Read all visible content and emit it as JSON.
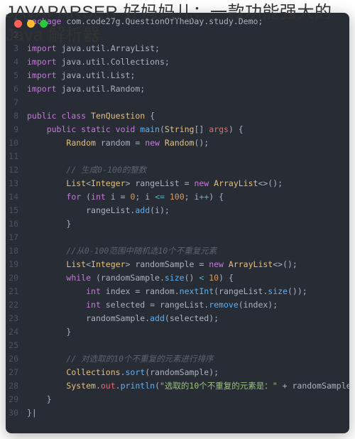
{
  "title": "JAVAPARSER 好妈妈儿：一款功能强大的 Java 解析器",
  "code": {
    "lines": [
      {
        "n": 1,
        "indent": 0,
        "tokens": [
          [
            "kw",
            "package"
          ],
          [
            "pkg",
            " com.code27g.QuestionOfTheDay.study.Demo"
          ],
          [
            "punct",
            ";"
          ]
        ]
      },
      {
        "n": 2,
        "indent": 0,
        "tokens": []
      },
      {
        "n": 3,
        "indent": 0,
        "tokens": [
          [
            "kw",
            "import"
          ],
          [
            "pkg",
            " java.util.ArrayList"
          ],
          [
            "punct",
            ";"
          ]
        ]
      },
      {
        "n": 4,
        "indent": 0,
        "tokens": [
          [
            "kw",
            "import"
          ],
          [
            "pkg",
            " java.util.Collections"
          ],
          [
            "punct",
            ";"
          ]
        ]
      },
      {
        "n": 5,
        "indent": 0,
        "tokens": [
          [
            "kw",
            "import"
          ],
          [
            "pkg",
            " java.util.List"
          ],
          [
            "punct",
            ";"
          ]
        ]
      },
      {
        "n": 6,
        "indent": 0,
        "tokens": [
          [
            "kw",
            "import"
          ],
          [
            "pkg",
            " java.util.Random"
          ],
          [
            "punct",
            ";"
          ]
        ]
      },
      {
        "n": 7,
        "indent": 0,
        "tokens": []
      },
      {
        "n": 8,
        "indent": 0,
        "tokens": [
          [
            "kw",
            "public class "
          ],
          [
            "type",
            "TenQuestion"
          ],
          [
            "punct",
            " {"
          ]
        ]
      },
      {
        "n": 9,
        "indent": 1,
        "tokens": [
          [
            "kw",
            "public static "
          ],
          [
            "kw",
            "void "
          ],
          [
            "fn",
            "main"
          ],
          [
            "punct",
            "("
          ],
          [
            "type",
            "String"
          ],
          [
            "punct",
            "[] "
          ],
          [
            "var",
            "args"
          ],
          [
            "punct",
            ") {"
          ]
        ]
      },
      {
        "n": 10,
        "indent": 2,
        "tokens": [
          [
            "type",
            "Random"
          ],
          [
            "punct",
            " random = "
          ],
          [
            "kw",
            "new "
          ],
          [
            "type",
            "Random"
          ],
          [
            "punct",
            "();"
          ]
        ]
      },
      {
        "n": 11,
        "indent": 0,
        "tokens": []
      },
      {
        "n": 12,
        "indent": 2,
        "tokens": [
          [
            "cm",
            "// 生成0-100的整数"
          ]
        ]
      },
      {
        "n": 13,
        "indent": 2,
        "tokens": [
          [
            "type",
            "List"
          ],
          [
            "punct",
            "<"
          ],
          [
            "type",
            "Integer"
          ],
          [
            "punct",
            "> rangeList = "
          ],
          [
            "kw",
            "new "
          ],
          [
            "type",
            "ArrayList"
          ],
          [
            "punct",
            "<>();"
          ]
        ]
      },
      {
        "n": 14,
        "indent": 2,
        "tokens": [
          [
            "kw",
            "for"
          ],
          [
            "punct",
            " ("
          ],
          [
            "kw",
            "int"
          ],
          [
            "punct",
            " i = "
          ],
          [
            "num",
            "0"
          ],
          [
            "punct",
            "; i "
          ],
          [
            "op",
            "<="
          ],
          [
            "punct",
            " "
          ],
          [
            "num",
            "100"
          ],
          [
            "punct",
            "; i"
          ],
          [
            "op",
            "++"
          ],
          [
            "punct",
            ") {"
          ]
        ]
      },
      {
        "n": 15,
        "indent": 3,
        "tokens": [
          [
            "punct",
            "rangeList."
          ],
          [
            "fn",
            "add"
          ],
          [
            "punct",
            "(i);"
          ]
        ]
      },
      {
        "n": 16,
        "indent": 2,
        "tokens": [
          [
            "punct",
            "}"
          ]
        ]
      },
      {
        "n": 17,
        "indent": 0,
        "tokens": []
      },
      {
        "n": 18,
        "indent": 2,
        "tokens": [
          [
            "cm",
            "//从0-100范围中随机选10个不重复元素"
          ]
        ]
      },
      {
        "n": 19,
        "indent": 2,
        "tokens": [
          [
            "type",
            "List"
          ],
          [
            "punct",
            "<"
          ],
          [
            "type",
            "Integer"
          ],
          [
            "punct",
            "> randomSample = "
          ],
          [
            "kw",
            "new "
          ],
          [
            "type",
            "ArrayList"
          ],
          [
            "punct",
            "<>();"
          ]
        ]
      },
      {
        "n": 20,
        "indent": 2,
        "tokens": [
          [
            "kw",
            "while"
          ],
          [
            "punct",
            " (randomSample."
          ],
          [
            "fn",
            "size"
          ],
          [
            "punct",
            "() "
          ],
          [
            "op",
            "<"
          ],
          [
            "punct",
            " "
          ],
          [
            "num",
            "10"
          ],
          [
            "punct",
            ") {"
          ]
        ]
      },
      {
        "n": 21,
        "indent": 3,
        "tokens": [
          [
            "kw",
            "int"
          ],
          [
            "punct",
            " index = random."
          ],
          [
            "fn",
            "nextInt"
          ],
          [
            "punct",
            "(rangeList."
          ],
          [
            "fn",
            "size"
          ],
          [
            "punct",
            "());"
          ]
        ]
      },
      {
        "n": 22,
        "indent": 3,
        "tokens": [
          [
            "kw",
            "int"
          ],
          [
            "punct",
            " selected = rangeList."
          ],
          [
            "fn",
            "remove"
          ],
          [
            "punct",
            "(index);"
          ]
        ]
      },
      {
        "n": 23,
        "indent": 3,
        "tokens": [
          [
            "punct",
            "randomSample."
          ],
          [
            "fn",
            "add"
          ],
          [
            "punct",
            "(selected);"
          ]
        ]
      },
      {
        "n": 24,
        "indent": 2,
        "tokens": [
          [
            "punct",
            "}"
          ]
        ]
      },
      {
        "n": 25,
        "indent": 0,
        "tokens": []
      },
      {
        "n": 26,
        "indent": 2,
        "tokens": [
          [
            "cm",
            "// 对选取的10个不重复的元素进行排序"
          ]
        ]
      },
      {
        "n": 27,
        "indent": 2,
        "tokens": [
          [
            "type",
            "Collections"
          ],
          [
            "punct",
            "."
          ],
          [
            "fn",
            "sort"
          ],
          [
            "punct",
            "(randomSample);"
          ]
        ]
      },
      {
        "n": 28,
        "indent": 2,
        "tokens": [
          [
            "type",
            "System"
          ],
          [
            "punct",
            "."
          ],
          [
            "var",
            "out"
          ],
          [
            "punct",
            "."
          ],
          [
            "fn",
            "println"
          ],
          [
            "punct",
            "("
          ],
          [
            "str",
            "\"选取的10个不重复的元素是：\""
          ],
          [
            "punct",
            " + randomSample);"
          ]
        ]
      },
      {
        "n": 29,
        "indent": 1,
        "tokens": [
          [
            "punct",
            "}"
          ]
        ]
      },
      {
        "n": 30,
        "indent": 0,
        "tokens": [
          [
            "punct",
            "}|"
          ]
        ]
      }
    ]
  }
}
